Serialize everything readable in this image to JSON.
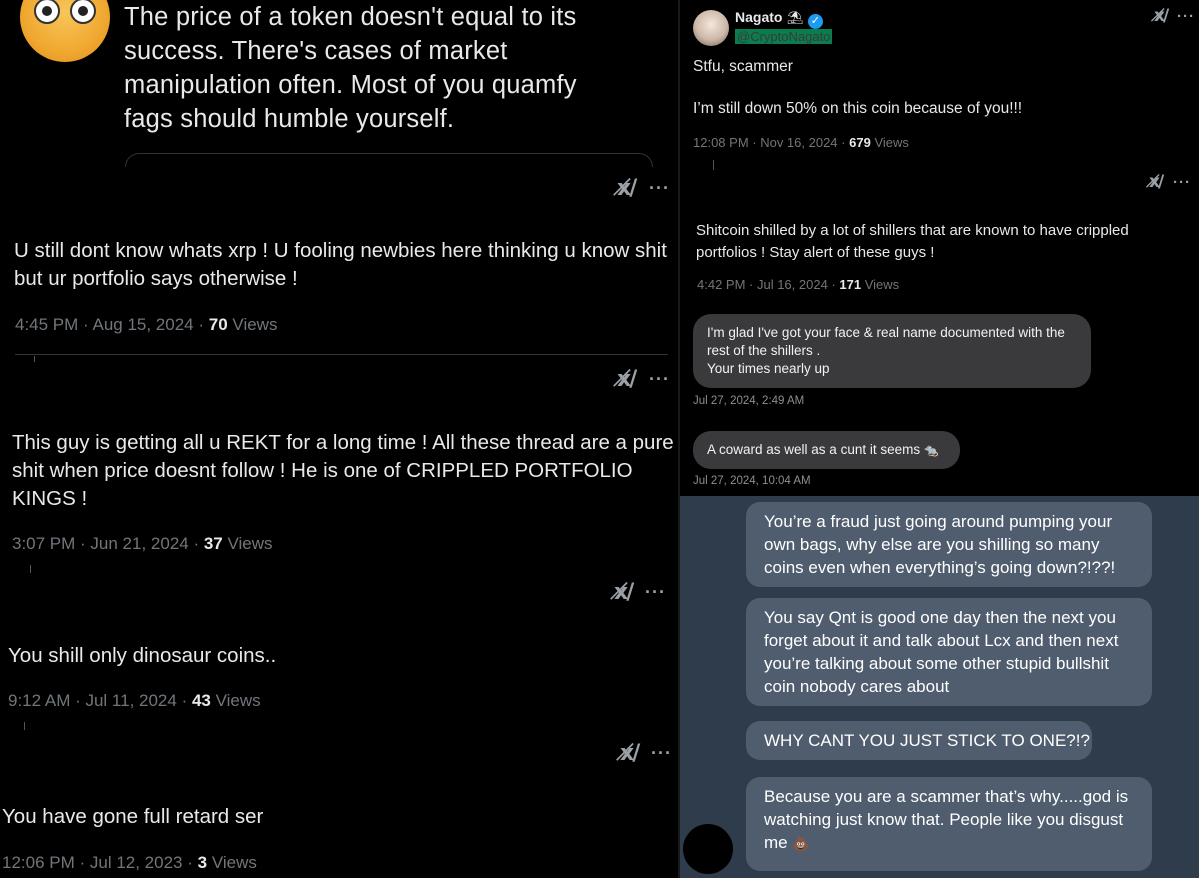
{
  "left_column": {
    "top_post": {
      "text_lines": [
        "The price of a token doesn't equal to its",
        "success. There's cases of market",
        "manipulation often. Most of you quamfy",
        "fags should humble yourself."
      ]
    },
    "grok_icon_label": "x̸/",
    "more_label": "···",
    "replies": [
      {
        "text_lines": [
          "U still dont know whats xrp ! U fooling newbies here thinking u know shit",
          "but ur portfolio says otherwise !"
        ],
        "time": "4:45 PM · Aug 15, 2024 ·",
        "views_count": "70",
        "views_label": "Views"
      },
      {
        "text_lines": [
          "This guy is getting all u REKT for a long time ! All these thread are a pure",
          "shit when price doesnt follow ! He is one of CRIPPLED PORTFOLIO",
          "KINGS !"
        ],
        "time": "3:07 PM · Jun 21, 2024 ·",
        "views_count": "37",
        "views_label": "Views"
      },
      {
        "text_lines": [
          "You shill only dinosaur coins.."
        ],
        "time": "9:12 AM · Jul 11, 2024 ·",
        "views_count": "43",
        "views_label": "Views"
      },
      {
        "text_lines": [
          "You have gone full retard ser"
        ],
        "time": "12:06 PM · Jul 12, 2023 ·",
        "views_count": "3",
        "views_label": "Views"
      }
    ]
  },
  "right_column": {
    "nagato_post": {
      "name": "Nagato",
      "name_emoji": "⛱",
      "verified": "✓",
      "handle": "@CryptoNagato",
      "line1": "Stfu, scammer",
      "line2": "I’m still down 50% on this coin because of you!!!",
      "time": "12:08 PM · Nov 16, 2024 ·",
      "views_count": "679",
      "views_label": "Views"
    },
    "shitcoin_post": {
      "text_lines": [
        "Shitcoin shilled by a lot of shillers that are known to have crippled",
        "portfolios ! Stay alert of these guys !"
      ],
      "time": "4:42 PM · Jul 16, 2024 ·",
      "views_count": "171",
      "views_label": "Views"
    },
    "dm_messages": [
      {
        "lines": [
          "I'm glad I've got your face & real name documented with the",
          "rest of the shillers .",
          "Your times nearly up"
        ],
        "time": "Jul 27, 2024, 2:49 AM"
      },
      {
        "lines": [
          "A coward as well as a cunt it seems"
        ],
        "emoji": "🐀",
        "time": "Jul 27, 2024, 10:04 AM"
      }
    ],
    "telegram_messages": [
      {
        "lines": [
          "You’re a fraud just going around pumping your",
          "own bags, why else are you shilling so many",
          "coins even when everything’s going down?!??!"
        ]
      },
      {
        "lines": [
          "You say Qnt is good one day then the next you",
          "forget about it and talk about Lcx and then next",
          "you’re talking about some other stupid bullshit",
          "coin nobody cares about"
        ]
      },
      {
        "lines": [
          "WHY CANT YOU JUST STICK TO ONE?!?"
        ]
      },
      {
        "lines": [
          "Because you are a scammer that’s why.....god is",
          "watching just know that. People like you disgust",
          "me"
        ],
        "emoji": "💩"
      }
    ]
  },
  "colors": {
    "background": "#000000",
    "text_primary": "#e7e9ea",
    "text_secondary": "#71767b",
    "dm_bubble": "#3a3a3c",
    "telegram_bg": "#2f3c4c",
    "telegram_bubble": "#4f5d6e",
    "verified_blue": "#1d9bf0"
  },
  "icons": [
    "grok-icon",
    "more-icon",
    "verified-icon",
    "avatar"
  ]
}
